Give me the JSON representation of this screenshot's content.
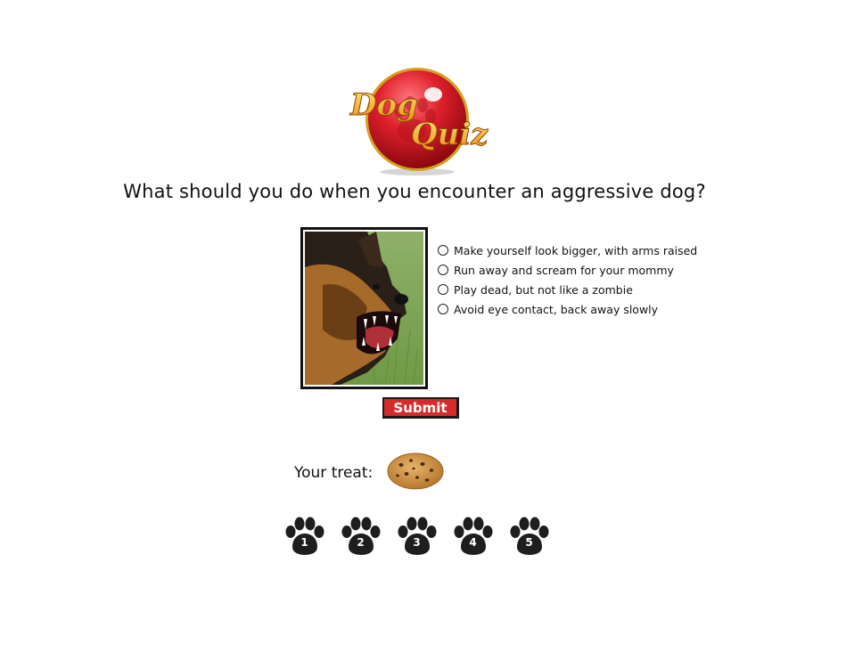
{
  "logo": {
    "line1": "Dog",
    "line2": "Quiz",
    "colors": {
      "ball": "#d8202a",
      "text": "#f6a623"
    }
  },
  "question": "What should you do when you encounter an aggressive dog?",
  "options": [
    {
      "label": "Make yourself look bigger, with arms raised",
      "selected": false
    },
    {
      "label": "Run away and scream for your mommy",
      "selected": false
    },
    {
      "label": "Play dead, but not like a zombie",
      "selected": false
    },
    {
      "label": "Avoid eye contact, back away slowly",
      "selected": false
    }
  ],
  "submit_label": "Submit",
  "treat": {
    "label": "Your treat:",
    "icon": "cookie-icon"
  },
  "paws": [
    "1",
    "2",
    "3",
    "4",
    "5"
  ],
  "colors": {
    "accent": "#d52b2b",
    "text": "#111111"
  }
}
